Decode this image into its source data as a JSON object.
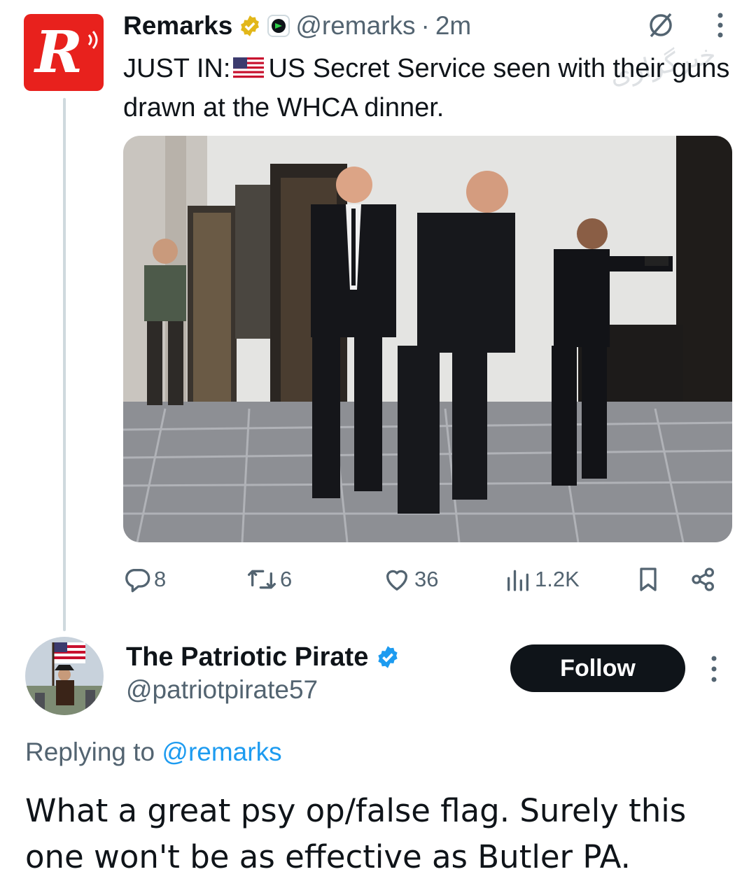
{
  "tweet": {
    "author": {
      "name": "Remarks",
      "handle": "@remarks",
      "separator": "·",
      "time": "2m"
    },
    "text_before_flag": "JUST IN:",
    "text_after_flag": "US Secret Service seen with their guns drawn at the WHCA dinner.",
    "flag_icon": "us-flag-emoji",
    "metrics": {
      "replies": "8",
      "reposts": "6",
      "likes": "36",
      "views": "1.2K"
    }
  },
  "reply": {
    "author": {
      "name": "The Patriotic Pirate",
      "handle": "@patriotpirate57"
    },
    "follow_label": "Follow",
    "replying_to_prefix": "Replying to",
    "replying_to_handle": "@remarks",
    "text": "What a great psy op/false flag. Surely this one won't be as effective as Butler PA."
  },
  "icons": {
    "verified_gold": "gold-verified-badge-icon",
    "affiliate": "affiliate-badge-icon",
    "grok": "grok-icon",
    "more": "more-vertical-icon",
    "reply": "reply-icon",
    "repost": "repost-icon",
    "like": "heart-icon",
    "views": "views-chart-icon",
    "bookmark": "bookmark-icon",
    "share": "share-icon",
    "verified_blue": "blue-verified-badge-icon"
  },
  "colors": {
    "accent": "#1d9bf0",
    "text_primary": "#0f1419",
    "text_secondary": "#536471",
    "brand_red": "#e8211d",
    "gold_badge": "#e2b719",
    "follow_bg": "#0f1419"
  }
}
